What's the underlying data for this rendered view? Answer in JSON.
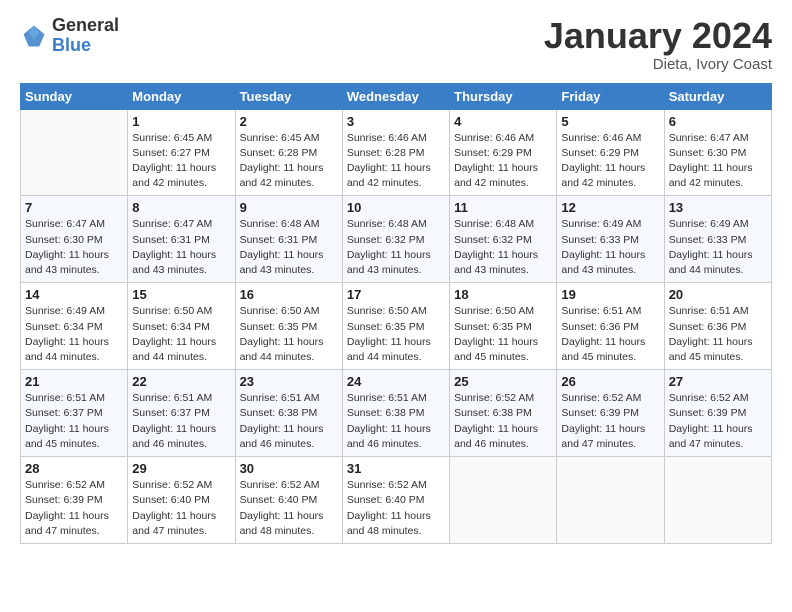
{
  "logo": {
    "general": "General",
    "blue": "Blue"
  },
  "title": "January 2024",
  "location": "Dieta, Ivory Coast",
  "days_of_week": [
    "Sunday",
    "Monday",
    "Tuesday",
    "Wednesday",
    "Thursday",
    "Friday",
    "Saturday"
  ],
  "weeks": [
    [
      {
        "day": "",
        "sunrise": "",
        "sunset": "",
        "daylight": ""
      },
      {
        "day": "1",
        "sunrise": "Sunrise: 6:45 AM",
        "sunset": "Sunset: 6:27 PM",
        "daylight": "Daylight: 11 hours and 42 minutes."
      },
      {
        "day": "2",
        "sunrise": "Sunrise: 6:45 AM",
        "sunset": "Sunset: 6:28 PM",
        "daylight": "Daylight: 11 hours and 42 minutes."
      },
      {
        "day": "3",
        "sunrise": "Sunrise: 6:46 AM",
        "sunset": "Sunset: 6:28 PM",
        "daylight": "Daylight: 11 hours and 42 minutes."
      },
      {
        "day": "4",
        "sunrise": "Sunrise: 6:46 AM",
        "sunset": "Sunset: 6:29 PM",
        "daylight": "Daylight: 11 hours and 42 minutes."
      },
      {
        "day": "5",
        "sunrise": "Sunrise: 6:46 AM",
        "sunset": "Sunset: 6:29 PM",
        "daylight": "Daylight: 11 hours and 42 minutes."
      },
      {
        "day": "6",
        "sunrise": "Sunrise: 6:47 AM",
        "sunset": "Sunset: 6:30 PM",
        "daylight": "Daylight: 11 hours and 42 minutes."
      }
    ],
    [
      {
        "day": "7",
        "sunrise": "Sunrise: 6:47 AM",
        "sunset": "Sunset: 6:30 PM",
        "daylight": "Daylight: 11 hours and 43 minutes."
      },
      {
        "day": "8",
        "sunrise": "Sunrise: 6:47 AM",
        "sunset": "Sunset: 6:31 PM",
        "daylight": "Daylight: 11 hours and 43 minutes."
      },
      {
        "day": "9",
        "sunrise": "Sunrise: 6:48 AM",
        "sunset": "Sunset: 6:31 PM",
        "daylight": "Daylight: 11 hours and 43 minutes."
      },
      {
        "day": "10",
        "sunrise": "Sunrise: 6:48 AM",
        "sunset": "Sunset: 6:32 PM",
        "daylight": "Daylight: 11 hours and 43 minutes."
      },
      {
        "day": "11",
        "sunrise": "Sunrise: 6:48 AM",
        "sunset": "Sunset: 6:32 PM",
        "daylight": "Daylight: 11 hours and 43 minutes."
      },
      {
        "day": "12",
        "sunrise": "Sunrise: 6:49 AM",
        "sunset": "Sunset: 6:33 PM",
        "daylight": "Daylight: 11 hours and 43 minutes."
      },
      {
        "day": "13",
        "sunrise": "Sunrise: 6:49 AM",
        "sunset": "Sunset: 6:33 PM",
        "daylight": "Daylight: 11 hours and 44 minutes."
      }
    ],
    [
      {
        "day": "14",
        "sunrise": "Sunrise: 6:49 AM",
        "sunset": "Sunset: 6:34 PM",
        "daylight": "Daylight: 11 hours and 44 minutes."
      },
      {
        "day": "15",
        "sunrise": "Sunrise: 6:50 AM",
        "sunset": "Sunset: 6:34 PM",
        "daylight": "Daylight: 11 hours and 44 minutes."
      },
      {
        "day": "16",
        "sunrise": "Sunrise: 6:50 AM",
        "sunset": "Sunset: 6:35 PM",
        "daylight": "Daylight: 11 hours and 44 minutes."
      },
      {
        "day": "17",
        "sunrise": "Sunrise: 6:50 AM",
        "sunset": "Sunset: 6:35 PM",
        "daylight": "Daylight: 11 hours and 44 minutes."
      },
      {
        "day": "18",
        "sunrise": "Sunrise: 6:50 AM",
        "sunset": "Sunset: 6:35 PM",
        "daylight": "Daylight: 11 hours and 45 minutes."
      },
      {
        "day": "19",
        "sunrise": "Sunrise: 6:51 AM",
        "sunset": "Sunset: 6:36 PM",
        "daylight": "Daylight: 11 hours and 45 minutes."
      },
      {
        "day": "20",
        "sunrise": "Sunrise: 6:51 AM",
        "sunset": "Sunset: 6:36 PM",
        "daylight": "Daylight: 11 hours and 45 minutes."
      }
    ],
    [
      {
        "day": "21",
        "sunrise": "Sunrise: 6:51 AM",
        "sunset": "Sunset: 6:37 PM",
        "daylight": "Daylight: 11 hours and 45 minutes."
      },
      {
        "day": "22",
        "sunrise": "Sunrise: 6:51 AM",
        "sunset": "Sunset: 6:37 PM",
        "daylight": "Daylight: 11 hours and 46 minutes."
      },
      {
        "day": "23",
        "sunrise": "Sunrise: 6:51 AM",
        "sunset": "Sunset: 6:38 PM",
        "daylight": "Daylight: 11 hours and 46 minutes."
      },
      {
        "day": "24",
        "sunrise": "Sunrise: 6:51 AM",
        "sunset": "Sunset: 6:38 PM",
        "daylight": "Daylight: 11 hours and 46 minutes."
      },
      {
        "day": "25",
        "sunrise": "Sunrise: 6:52 AM",
        "sunset": "Sunset: 6:38 PM",
        "daylight": "Daylight: 11 hours and 46 minutes."
      },
      {
        "day": "26",
        "sunrise": "Sunrise: 6:52 AM",
        "sunset": "Sunset: 6:39 PM",
        "daylight": "Daylight: 11 hours and 47 minutes."
      },
      {
        "day": "27",
        "sunrise": "Sunrise: 6:52 AM",
        "sunset": "Sunset: 6:39 PM",
        "daylight": "Daylight: 11 hours and 47 minutes."
      }
    ],
    [
      {
        "day": "28",
        "sunrise": "Sunrise: 6:52 AM",
        "sunset": "Sunset: 6:39 PM",
        "daylight": "Daylight: 11 hours and 47 minutes."
      },
      {
        "day": "29",
        "sunrise": "Sunrise: 6:52 AM",
        "sunset": "Sunset: 6:40 PM",
        "daylight": "Daylight: 11 hours and 47 minutes."
      },
      {
        "day": "30",
        "sunrise": "Sunrise: 6:52 AM",
        "sunset": "Sunset: 6:40 PM",
        "daylight": "Daylight: 11 hours and 48 minutes."
      },
      {
        "day": "31",
        "sunrise": "Sunrise: 6:52 AM",
        "sunset": "Sunset: 6:40 PM",
        "daylight": "Daylight: 11 hours and 48 minutes."
      },
      {
        "day": "",
        "sunrise": "",
        "sunset": "",
        "daylight": ""
      },
      {
        "day": "",
        "sunrise": "",
        "sunset": "",
        "daylight": ""
      },
      {
        "day": "",
        "sunrise": "",
        "sunset": "",
        "daylight": ""
      }
    ]
  ]
}
